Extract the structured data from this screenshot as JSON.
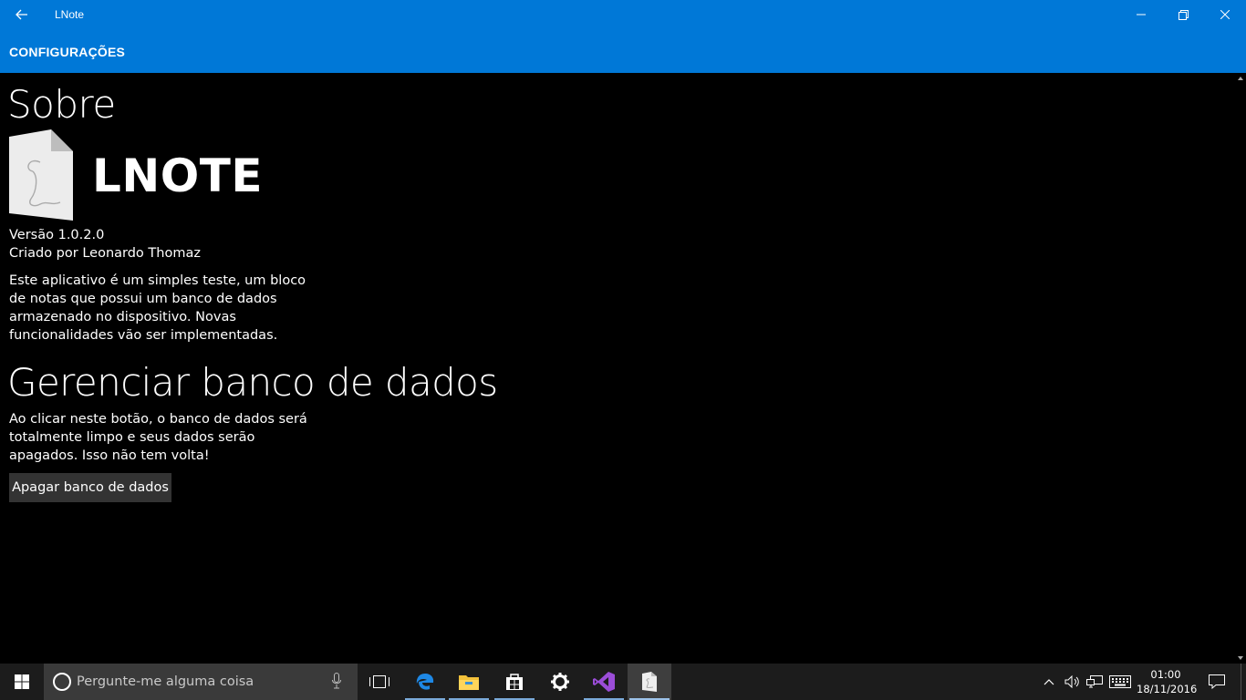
{
  "window": {
    "title": "LNote",
    "back_icon": "back-arrow-icon",
    "controls": [
      "minimize-icon",
      "maximize-icon",
      "close-icon"
    ]
  },
  "header": {
    "page_title": "CONFIGURAÇÕES",
    "background": "#0078d7"
  },
  "about": {
    "heading": "Sobre",
    "app_logo_icon": "lnote-document-icon",
    "app_name": "LNOTE",
    "version": "Versão 1.0.2.0",
    "author": "Criado por Leonardo Thomaz",
    "description": "Este aplicativo é um simples teste, um bloco de notas que possui um banco de dados armazenado no dispositivo. Novas funcionalidades vão ser implementadas."
  },
  "database": {
    "heading": "Gerenciar banco de dados",
    "warning": "Ao clicar neste botão, o banco de dados será totalmente limpo e seus dados serão apagados. Isso não tem volta!",
    "button_label": "Apagar banco de dados"
  },
  "taskbar": {
    "search_placeholder": "Pergunte-me alguma coisa",
    "pinned": [
      "task-view-icon",
      "edge-icon",
      "file-explorer-icon",
      "store-icon",
      "settings-icon",
      "visual-studio-icon",
      "lnote-icon"
    ],
    "clock_time": "01:00",
    "clock_date": "18/11/2016"
  }
}
